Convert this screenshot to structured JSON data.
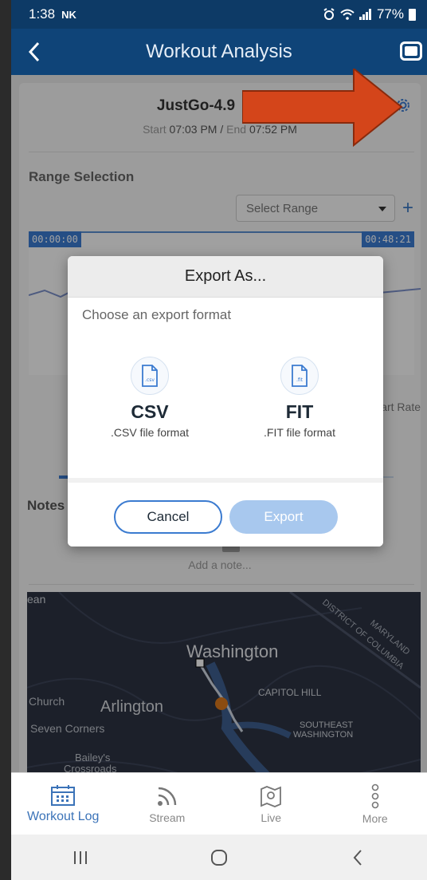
{
  "status_bar": {
    "time": "1:38",
    "carrier_badge": "NK",
    "battery": "77%"
  },
  "app_bar": {
    "title": "Workout Analysis"
  },
  "workout": {
    "name": "JustGo-4.9",
    "start_label": "Start",
    "start_time": "07:03 PM",
    "separator": "/",
    "end_label": "End",
    "end_time": "07:52 PM"
  },
  "range": {
    "title": "Range Selection",
    "select_placeholder": "Select Range",
    "plus": "+",
    "start_tag": "00:00:00",
    "end_tag": "00:48:21",
    "metric_label": "Heart Rate"
  },
  "notes": {
    "title": "Notes",
    "add_note": "Add a note..."
  },
  "map": {
    "labels": [
      "ean",
      "Washington",
      "Arlington",
      "Church",
      "Seven Corners",
      "Bailey's",
      "Crossroads",
      "CAPITOL HILL",
      "SOUTHEAST",
      "WASHINGTON",
      "MARYLAND",
      "DISTRICT OF COLUMBIA"
    ]
  },
  "dialog": {
    "title": "Export As...",
    "subtitle": "Choose an export format",
    "formats": [
      {
        "icon_text": ".csv",
        "name": "CSV",
        "desc": ".CSV file format"
      },
      {
        "icon_text": ".fit",
        "name": "FIT",
        "desc": ".FIT file format"
      }
    ],
    "cancel": "Cancel",
    "export": "Export"
  },
  "bottom_nav": [
    {
      "label": "Workout Log",
      "icon": "calendar-icon",
      "active": true
    },
    {
      "label": "Stream",
      "icon": "rss-icon",
      "active": false
    },
    {
      "label": "Live",
      "icon": "map-icon",
      "active": false
    },
    {
      "label": "More",
      "icon": "more-icon",
      "active": false
    }
  ],
  "colors": {
    "primary": "#0f4478",
    "accent": "#3b7bd0",
    "arrow": "#d4451a"
  }
}
